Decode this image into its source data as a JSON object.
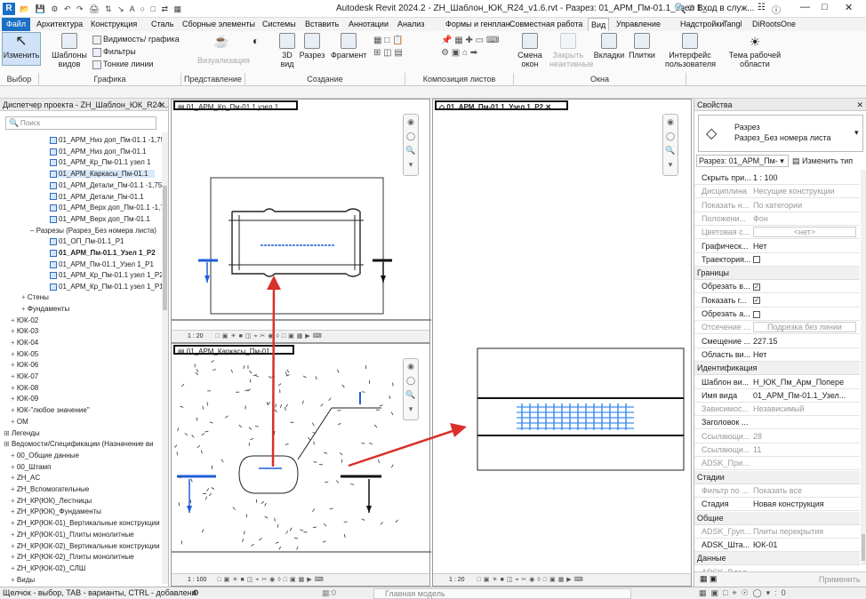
{
  "titlebar": {
    "title": "Autodesk Revit 2024.2 - ZH_Шаблон_ЮК_R24_v1.6.rvt - Разрез: 01_АРМ_Пм-01.1_Узел 1_...",
    "login": "Вход в служ...",
    "app_icon": "R"
  },
  "ribbon_tabs": [
    "Файл",
    "Архитектура",
    "Конструкция",
    "Сталь",
    "Сборные элементы",
    "Системы",
    "Вставить",
    "Аннотации",
    "Анализ",
    "Формы и генплан",
    "Совместная работа",
    "Вид",
    "Управление",
    "Надстройки",
    "Tangl",
    "DiRootsOne"
  ],
  "ribbon": {
    "modify": "Изменить",
    "templates": "Шаблоны видов",
    "visibility": "Видимость/ графика",
    "filters": "Фильтры",
    "thin_lines": "Тонкие линии",
    "visualization": "Визуализация",
    "view3d": "3D вид",
    "section": "Разрез",
    "fragment": "Фрагмент",
    "switch_windows": "Смена окон",
    "close_inactive": "Закрыть неактивные",
    "tabs_btn": "Вкладки",
    "tiles": "Плитки",
    "user_interface": "Интерфейс пользователя",
    "theme": "Тема рабочей области",
    "groups": [
      "Выбор",
      "Графика",
      "Представление",
      "Создание",
      "Композиция листов",
      "Окна"
    ]
  },
  "browser": {
    "header": "Диспетчер проекта - ZH_Шаблон_ЮК_R24...",
    "search_placeholder": "Поиск",
    "items": [
      {
        "t": "01_АРМ_Низ доп_Пм-01.1 -1,750",
        "kind": "view"
      },
      {
        "t": "01_АРМ_Низ доп_Пм-01.1",
        "kind": "view"
      },
      {
        "t": "01_АРМ_Кр_Пм-01.1 узел 1",
        "kind": "view"
      },
      {
        "t": "01_АРМ_Каркасы_Пм-01.1",
        "kind": "view"
      },
      {
        "t": "01_АРМ_Детали_Пм-01.1 -1,750",
        "kind": "view"
      },
      {
        "t": "01_АРМ_Детали_Пм-01.1",
        "kind": "view"
      },
      {
        "t": "01_АРМ_Верх доп_Пм-01.1 -1,75",
        "kind": "view"
      },
      {
        "t": "01_АРМ_Верх доп_Пм-01.1",
        "kind": "view"
      },
      {
        "t": "Разрезы (Разрез_Без номера листа)",
        "kind": "group"
      },
      {
        "t": "01_ОП_Пм-01.1_Р1",
        "kind": "view"
      },
      {
        "t": "01_АРМ_Пм-01.1_Узел 1_Р2",
        "kind": "active"
      },
      {
        "t": "01_АРМ_Пм-01.1_Узел 1_Р1",
        "kind": "view"
      },
      {
        "t": "01_АРМ_Кр_Пм-01.1 узел 1_Р2",
        "kind": "view"
      },
      {
        "t": "01_АРМ_Кр_Пм-01.1 узел 1_Р1",
        "kind": "view"
      },
      {
        "t": "Стены",
        "kind": "folder"
      },
      {
        "t": "Фундаменты",
        "kind": "folder"
      },
      {
        "t": "ЮК-02",
        "kind": "folder"
      },
      {
        "t": "ЮК-03",
        "kind": "folder"
      },
      {
        "t": "ЮК-04",
        "kind": "folder"
      },
      {
        "t": "ЮК-05",
        "kind": "folder"
      },
      {
        "t": "ЮК-06",
        "kind": "folder"
      },
      {
        "t": "ЮК-07",
        "kind": "folder"
      },
      {
        "t": "ЮК-08",
        "kind": "folder"
      },
      {
        "t": "ЮК-09",
        "kind": "folder"
      },
      {
        "t": "ЮК-\"любое значение\"",
        "kind": "folder"
      },
      {
        "t": "ОМ",
        "kind": "folder"
      },
      {
        "t": "Легенды",
        "kind": "root"
      },
      {
        "t": "Ведомости/Спецификации (Назначение ви",
        "kind": "root"
      },
      {
        "t": "00_Общие данные",
        "kind": "folder"
      },
      {
        "t": "00_Штамп",
        "kind": "folder"
      },
      {
        "t": "ZH_AC",
        "kind": "folder"
      },
      {
        "t": "ZH_Вспомогательные",
        "kind": "folder"
      },
      {
        "t": "ZH_КР(ЮК)_Лестницы",
        "kind": "folder"
      },
      {
        "t": "ZH_КР(ЮК)_Фундаменты",
        "kind": "folder"
      },
      {
        "t": "ZH_КР(ЮК-01)_Вертикальные конструкции",
        "kind": "folder"
      },
      {
        "t": "ZH_КР(ЮК-01)_Плиты монолитные",
        "kind": "folder"
      },
      {
        "t": "ZH_КР(ЮК-02)_Вертикальные конструкции",
        "kind": "folder"
      },
      {
        "t": "ZH_КР(ЮК-02)_Плиты монолитные",
        "kind": "folder"
      },
      {
        "t": "ZH_КР(ЮК-02)_СЛШ",
        "kind": "folder"
      },
      {
        "t": "Виды",
        "kind": "folder"
      }
    ]
  },
  "views": {
    "v1_tab": "01_АРМ_Кр_Пм-01.1 узел 1",
    "v1_scale": "1 : 20",
    "v2_tab": "01_АРМ_Каркасы_Пм-01.1",
    "v2_scale": "1 : 100",
    "v3_tab": "01_АРМ_Пм-01.1_Узел 1_Р2",
    "v3_scale": "1 : 20"
  },
  "props": {
    "header": "Свойства",
    "type_line1": "Разрез",
    "type_line2": "Разрез_Без номера листа",
    "selector": "Разрез: 01_АРМ_Пм-",
    "edit_type": "Изменить тип",
    "rows": [
      {
        "k": "Скрыть при...",
        "v": "1 : 100",
        "dis": false
      },
      {
        "k": "Дисциплина",
        "v": "Несущие конструкции",
        "dis": true
      },
      {
        "k": "Показать н...",
        "v": "По категории",
        "dis": true
      },
      {
        "k": "Положени...",
        "v": "Фон",
        "dis": true
      },
      {
        "k": "Цветовая с...",
        "v": "<нет>",
        "dis": true
      },
      {
        "k": "Графическ...",
        "v": "Нет",
        "dis": false
      },
      {
        "k": "Траектория...",
        "v": "",
        "dis": false,
        "chk": ""
      }
    ],
    "sec_bounds": "Границы",
    "rows_bounds": [
      {
        "k": "Обрезать в...",
        "v": "",
        "dis": false,
        "chk": "✓"
      },
      {
        "k": "Показать г...",
        "v": "",
        "dis": false,
        "chk": "✓"
      },
      {
        "k": "Обрезать а...",
        "v": "",
        "dis": false,
        "chk": ""
      },
      {
        "k": "Отсечение ...",
        "v": "Подрезка без линии",
        "dis": true
      },
      {
        "k": "Смещение ...",
        "v": "227.15",
        "dis": false
      },
      {
        "k": "Область ви...",
        "v": "Нет",
        "dis": false
      }
    ],
    "sec_ident": "Идентификация",
    "rows_ident": [
      {
        "k": "Шаблон ви...",
        "v": "H_ЮК_Пм_Арм_Попере",
        "dis": false
      },
      {
        "k": "Имя вида",
        "v": "01_АРМ_Пм-01.1_Узел...",
        "dis": false
      },
      {
        "k": "Зависимос...",
        "v": "Независимый",
        "dis": true
      },
      {
        "k": "Заголовок ...",
        "v": "",
        "dis": false
      },
      {
        "k": "Ссылающи...",
        "v": "28",
        "dis": true
      },
      {
        "k": "Ссылающи...",
        "v": "11",
        "dis": true
      },
      {
        "k": "ADSK_При...",
        "v": "",
        "dis": true
      }
    ],
    "sec_stages": "Стадии",
    "rows_stages": [
      {
        "k": "Фильтр по ...",
        "v": "Показать все",
        "dis": true
      },
      {
        "k": "Стадия",
        "v": "Новая конструкция",
        "dis": false
      }
    ],
    "sec_common": "Общие",
    "rows_common": [
      {
        "k": "ADSK_Груп...",
        "v": "Плиты перекрытия",
        "dis": true
      },
      {
        "k": "ADSK_Шта...",
        "v": "ЮК-01",
        "dis": false
      }
    ],
    "sec_data": "Данные",
    "row_data": "ADSK_Влад...",
    "apply": "Применить"
  },
  "status": {
    "text": "Щелчок - выбор, TAB - варианты, CTRL - добавлени",
    "zero1": ":0",
    "model": "Главная модель",
    "zero2": ":0"
  },
  "colors": {
    "accent": "#1a6fc6",
    "rebar": "#1f5fd8",
    "arrow": "#d9302a"
  }
}
